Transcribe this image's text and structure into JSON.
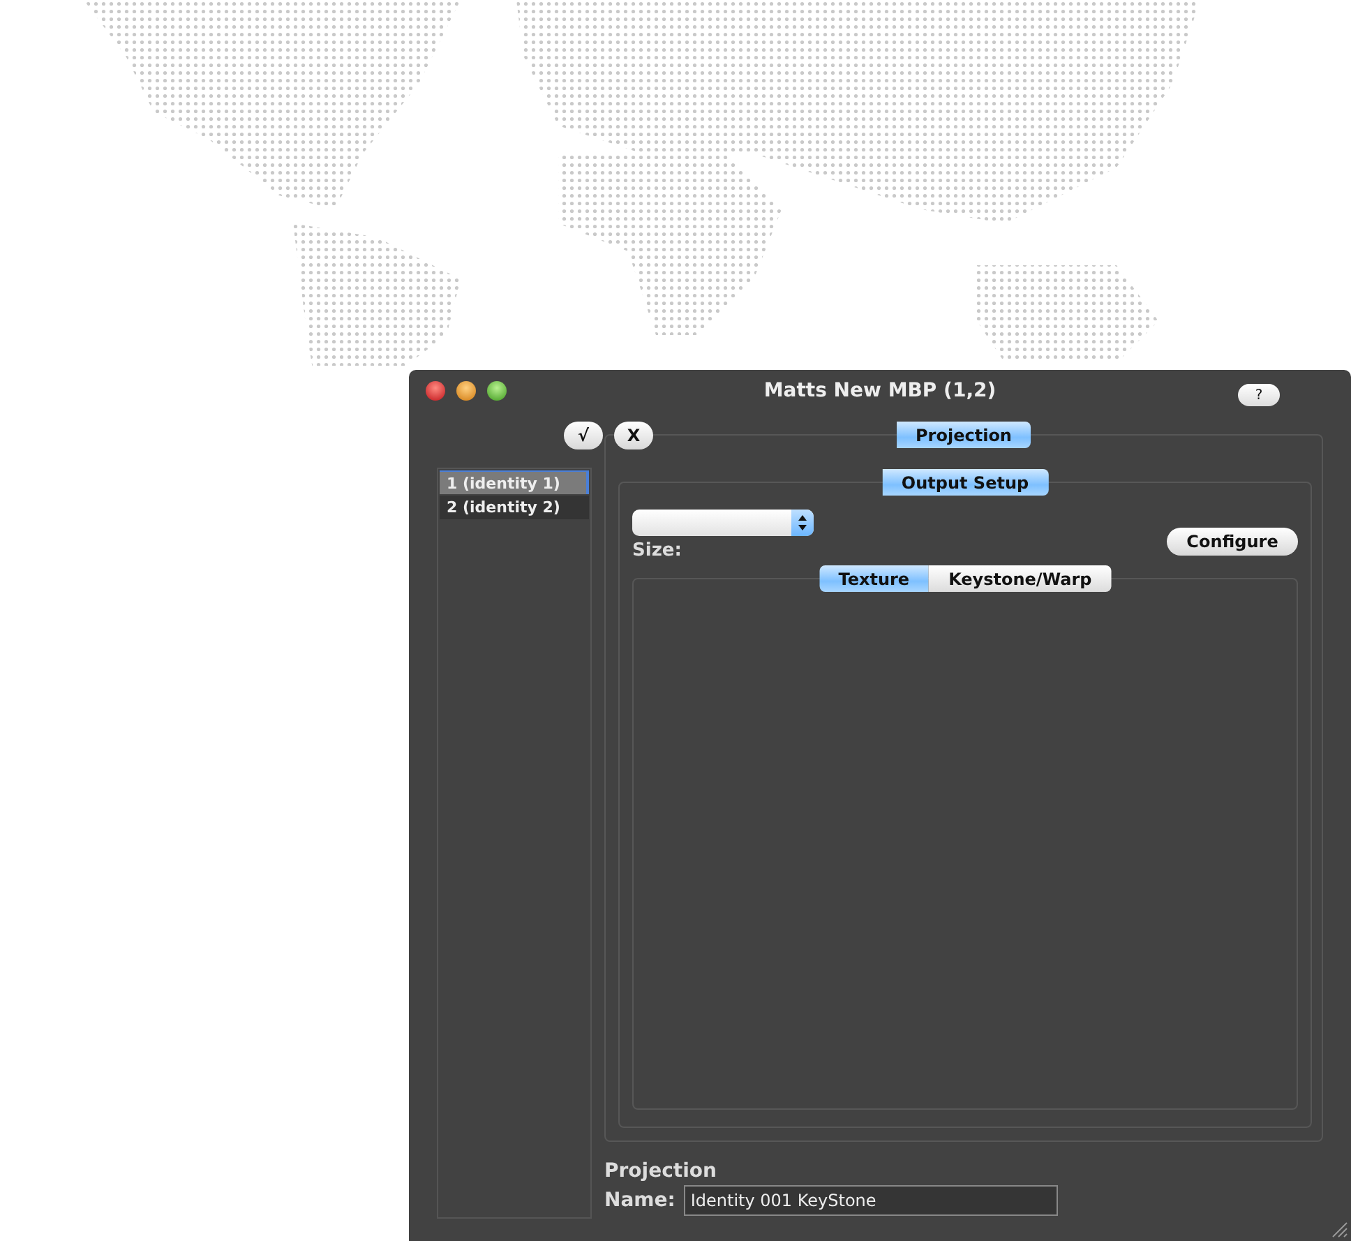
{
  "window": {
    "title": "Matts New MBP (1,2)",
    "help_button": "?"
  },
  "toolbar": {
    "buttons": [
      "√",
      "X"
    ]
  },
  "identities": [
    {
      "label": "1 (identity 1)",
      "selected": true
    },
    {
      "label": "2 (identity 2)",
      "selected": false
    }
  ],
  "main_tabs": [
    {
      "label": "Projection",
      "selected": true
    }
  ],
  "sub_tabs": [
    {
      "label": "Output Setup",
      "selected": true
    }
  ],
  "output_setup": {
    "configure_button": "Configure",
    "size_label": "Size:",
    "view_tabs": [
      {
        "label": "Texture",
        "selected": true
      },
      {
        "label": "Keystone/Warp",
        "selected": false
      }
    ]
  },
  "footer": {
    "heading": "Projection",
    "name_label": "Name:",
    "name_value": "Identity 001 KeyStone"
  }
}
